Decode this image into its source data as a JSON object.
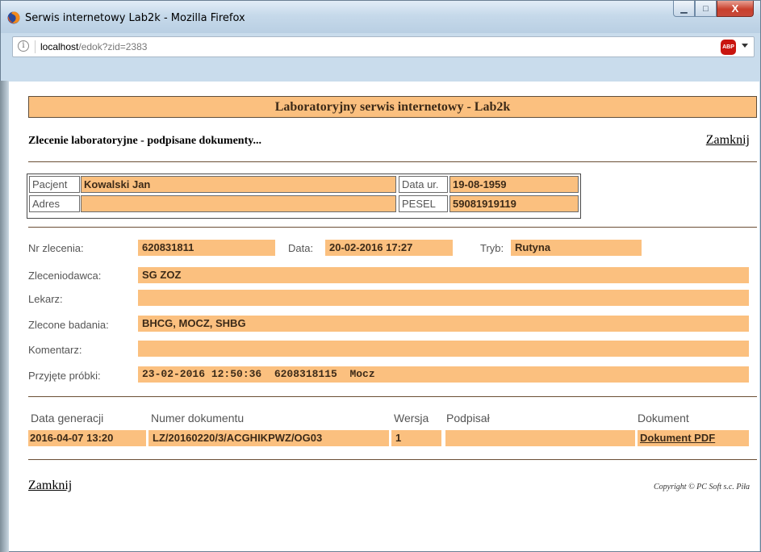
{
  "window": {
    "title": "Serwis internetowy Lab2k - Mozilla Firefox",
    "min_glyph": "▁",
    "max_glyph": "□",
    "close_glyph": "X"
  },
  "urlbar": {
    "host": "localhost",
    "path": "/edok?zid=2383",
    "info_glyph": "i",
    "abp_label": "ABP"
  },
  "page": {
    "banner": "Laboratoryjny serwis internetowy - Lab2k",
    "subtitle": "Zlecenie laboratoryjne - podpisane dokumenty...",
    "close_label": "Zamknij",
    "copyright": "Copyright © PC Soft s.c. Piła"
  },
  "patient": {
    "name_label": "Pacjent",
    "name": "Kowalski Jan",
    "dob_label": "Data ur.",
    "dob": "19-08-1959",
    "address_label": "Adres",
    "address": "",
    "pesel_label": "PESEL",
    "pesel": "59081919119"
  },
  "order": {
    "number_label": "Nr zlecenia:",
    "number": "620831811",
    "date_label": "Data:",
    "date": "20-02-2016 17:27",
    "mode_label": "Tryb:",
    "mode": "Rutyna",
    "orderer_label": "Zleceniodawca:",
    "orderer": "SG ZOZ",
    "doctor_label": "Lekarz:",
    "doctor": "",
    "tests_label": "Zlecone badania:",
    "tests": "BHCG, MOCZ, SHBG",
    "comment_label": "Komentarz:",
    "comment": "",
    "samples_label": "Przyjęte próbki:",
    "samples": "23-02-2016 12:50:36  6208318115  Mocz"
  },
  "documents": {
    "headers": [
      "Data generacji",
      "Numer dokumentu",
      "Wersja",
      "Podpisał",
      "Dokument"
    ],
    "rows": [
      {
        "generated": "2016-04-07 13:20",
        "number": "LZ/20160220/3/ACGHIKPWZ/OG03",
        "version": "1",
        "signed_by": "",
        "document": "Dokument PDF"
      }
    ]
  },
  "colors": {
    "field_bg": "#fbc07f",
    "divider": "#6b4e35",
    "chrome": "#c9dcec"
  }
}
